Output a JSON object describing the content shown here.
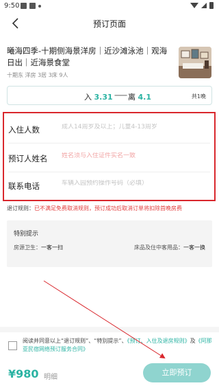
{
  "status_bar": {
    "time": "9:50"
  },
  "nav": {
    "title": "预订页面"
  },
  "listing": {
    "title": "曦海四季-十期侧海景洋房｜近沙滩泳池｜观海日出｜近海景食堂",
    "meta": "十期东 洋房 3居 3床 9人"
  },
  "dates": {
    "checkin_label": "入",
    "checkin_date": "3.31",
    "separator": "一一",
    "checkout_label": "离",
    "checkout_date": "4.1",
    "nights_prefix": "共",
    "nights_count": "1",
    "nights_suffix": "晚"
  },
  "form": {
    "guests": {
      "label": "入住人数",
      "placeholder": "成人14周岁及以上；儿童4-13周岁"
    },
    "name": {
      "label": "预订人姓名",
      "placeholder": "姓名须与入住证件实名一致"
    },
    "phone": {
      "label": "联系电话",
      "placeholder": "车辆入园预约操作号码（必填）"
    }
  },
  "rule": {
    "label": "退订规则：",
    "text": "已不满足免费取消规则，预订成功后取消订单将扣除首晚房费"
  },
  "tips": {
    "title": "特别提示",
    "left_label": "房源卫生：",
    "left_value": "一客一扫",
    "right_label": "床品及住中客用品：",
    "right_value": "一客一换"
  },
  "agreement": {
    "prefix": "阅读并同意以上“退订规则”、“特别提示”、",
    "link1": "《预订、入住及退房规则》",
    "middle": "及",
    "link2": "《阿那亚民宿网络预订服务合同》"
  },
  "bottom": {
    "price": "¥980",
    "detail_label": "明细",
    "book_label": "立即预订"
  },
  "colors": {
    "accent": "#2bb3a3",
    "book_button": "#8fd4cf",
    "highlight_border": "#d9262c",
    "rule_text": "#e23b3b"
  }
}
